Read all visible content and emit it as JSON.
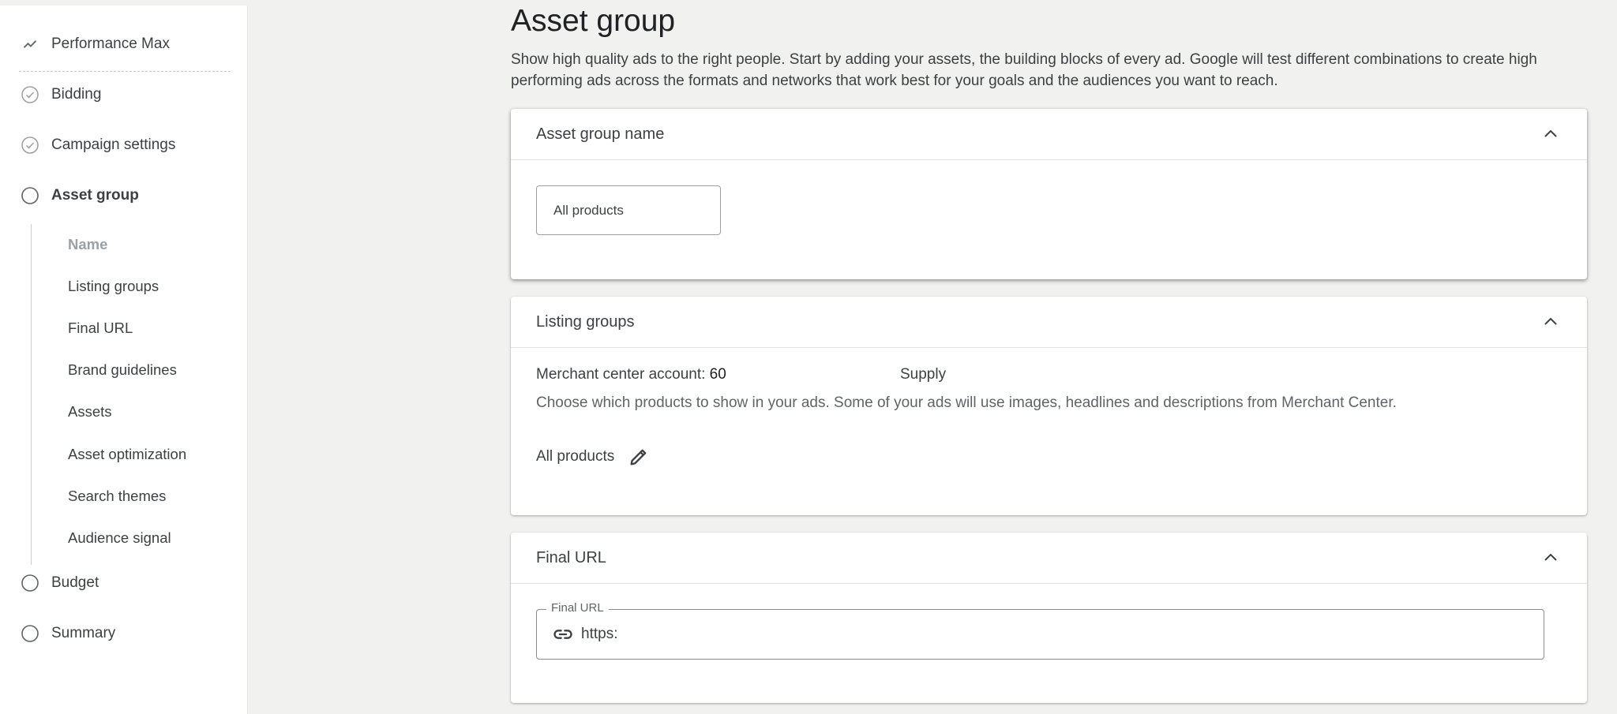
{
  "sidebar": {
    "items": [
      {
        "label": "Performance Max",
        "icon": "trending-icon"
      },
      {
        "label": "Bidding",
        "icon": "check-circle-icon"
      },
      {
        "label": "Campaign settings",
        "icon": "check-circle-icon"
      },
      {
        "label": "Asset group",
        "icon": "circle-icon"
      },
      {
        "label": "Budget",
        "icon": "circle-icon"
      },
      {
        "label": "Summary",
        "icon": "circle-icon"
      }
    ],
    "subitems": [
      "Name",
      "Listing groups",
      "Final URL",
      "Brand guidelines",
      "Assets",
      "Asset optimization",
      "Search themes",
      "Audience signal"
    ]
  },
  "main": {
    "title": "Asset group",
    "description": "Show high quality ads to the right people. Start by adding your assets, the building blocks of every ad. Google will test different combinations to create high performing ads across the formats and networks that work best for your goals and the audiences you want to reach.",
    "name_card": {
      "title": "Asset group name",
      "input_value": "All products"
    },
    "listing_card": {
      "title": "Listing groups",
      "merchant_label": "Merchant center account:",
      "merchant_value": "60",
      "supply": "Supply",
      "description": "Choose which products to show in your ads. Some of your ads will use images, headlines and descriptions from Merchant Center.",
      "products": "All products"
    },
    "url_card": {
      "title": "Final URL",
      "field_label": "Final URL",
      "field_value": "https:"
    }
  },
  "colors": {
    "background": "#f1f1f0",
    "text": "#3c4043",
    "muted": "#9aa0a6"
  }
}
